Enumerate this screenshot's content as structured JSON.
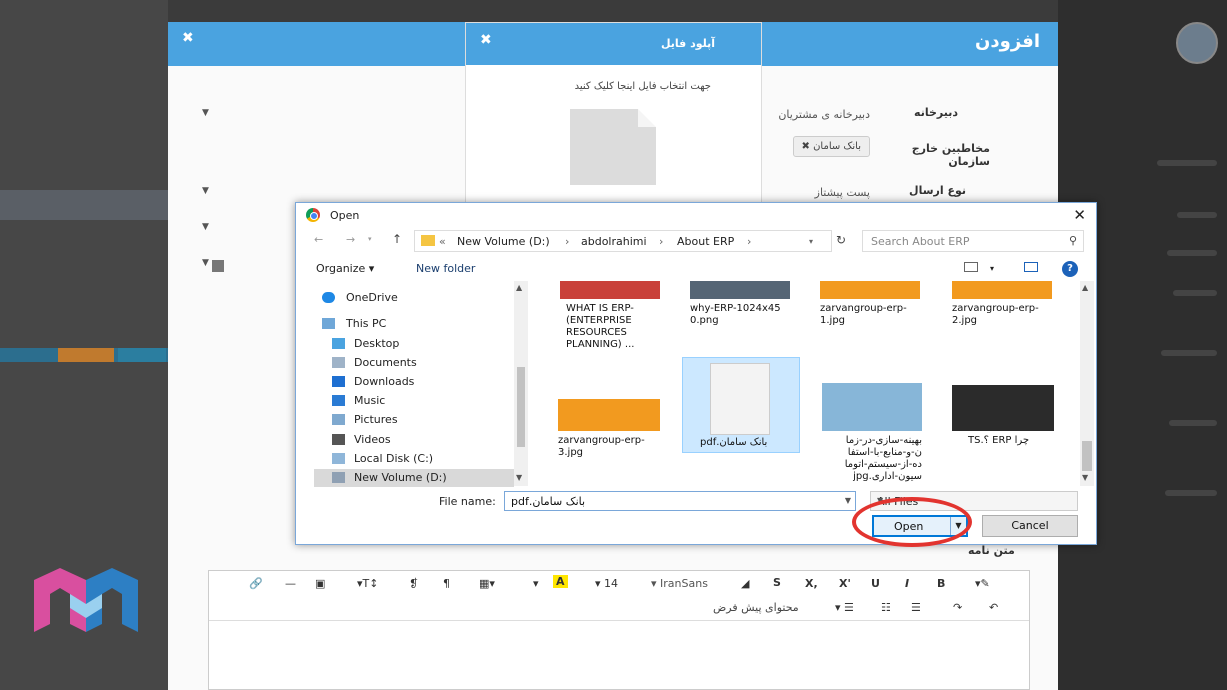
{
  "form": {
    "title": "افزودن",
    "close": "✖",
    "fields": [
      {
        "label": "دبیرخانه",
        "value": "دبیرخانه ی مشتریان"
      },
      {
        "label": "مخاطبین خارج سازمان",
        "value": ""
      },
      {
        "label": "نوع ارسال",
        "value": "پست پیشتاز"
      }
    ],
    "tag": "بانک سامان ✖",
    "body_label": "متن نامه"
  },
  "upload": {
    "title": "آپلود فایل",
    "close": "✖",
    "hint": "جهت انتخاب فایل اینجا کلیک کنید"
  },
  "editor": {
    "font": "IranSans",
    "size": "14",
    "style": "محتوای پیش فرض"
  },
  "open_dialog": {
    "title": "Open",
    "path": [
      "New Volume (D:)",
      "abdolrahimi",
      "About ERP"
    ],
    "search_placeholder": "Search About ERP",
    "organize": "Organize ▾",
    "new_folder": "New folder",
    "nav": [
      {
        "label": "OneDrive",
        "icon": "cloud-icon"
      },
      {
        "label": "This PC",
        "icon": "pc-icon"
      },
      {
        "label": "Desktop",
        "icon": "desktop-icon"
      },
      {
        "label": "Documents",
        "icon": "documents-icon"
      },
      {
        "label": "Downloads",
        "icon": "downloads-icon"
      },
      {
        "label": "Music",
        "icon": "music-icon"
      },
      {
        "label": "Pictures",
        "icon": "pictures-icon"
      },
      {
        "label": "Videos",
        "icon": "videos-icon"
      },
      {
        "label": "Local Disk (C:)",
        "icon": "disk-icon"
      },
      {
        "label": "New Volume (D:)",
        "icon": "disk-icon"
      }
    ],
    "files": [
      {
        "name": "WHAT IS ERP-\n(ENTERPRISE\nRESOURCES\nPLANNING) ...",
        "thumb": "#c9413a"
      },
      {
        "name": "why-ERP-1024x45\n0.png",
        "thumb": "#556575"
      },
      {
        "name": "zarvangroup-erp-\n1.jpg",
        "thumb": "#f29a1f"
      },
      {
        "name": "zarvangroup-erp-\n2.jpg",
        "thumb": "#f29a1f"
      },
      {
        "name": "zarvangroup-erp-\n3.jpg",
        "thumb": "#f29a1f"
      },
      {
        "name": "بانک سامان.pdf",
        "thumb": "#f3f3f3"
      },
      {
        "name": "بهینه-سازی-در-زما\nن-و-منابع-با-استفا\nده-از-سیستم-اتوما\nسیون-اداری.jpg",
        "thumb": "#87b6d8"
      },
      {
        "name": "چرا ERP ؟.TS",
        "thumb": "#2b2b2b"
      }
    ],
    "file_name_label": "File name:",
    "file_name_value": "بانک سامان.pdf",
    "filter": "All Files",
    "open_label": "Open",
    "cancel_label": "Cancel",
    "colors": {
      "accent": "#0078d7",
      "highlight": "#e2342f"
    }
  }
}
